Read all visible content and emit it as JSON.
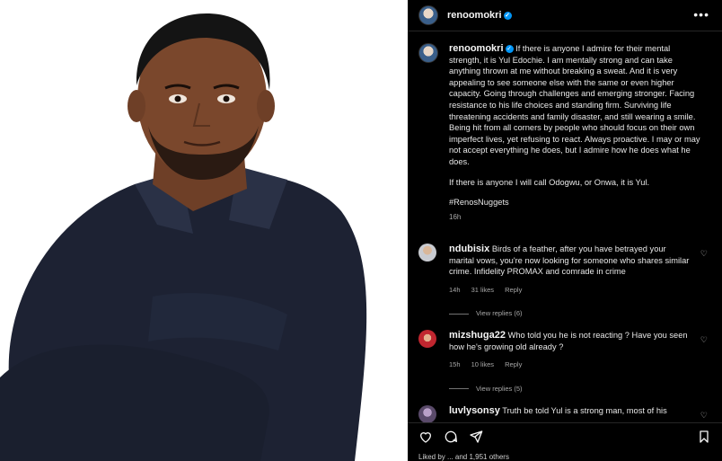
{
  "post": {
    "username": "renoomokri",
    "verified_mark": "✓",
    "more_icon": "more-horizontal-icon"
  },
  "caption": {
    "username": "renoomokri",
    "paragraph1": "If there is anyone I admire for their mental strength, it is Yul Edochie. I am mentally strong and can take anything thrown at me without breaking a sweat. And it is very appealing to see someone else with the same or even higher capacity. Going through challenges and emerging stronger. Facing resistance to his life choices and standing firm. Surviving life threatening accidents and family disaster, and still wearing a smile. Being hit from all corners by people who should focus on their own imperfect lives, yet refusing to react. Always proactive. I may or may not accept everything he does, but I admire how he does what he does.",
    "paragraph2": "If there is anyone I will call Odogwu, or Onwa, it is Yul.",
    "hashtag": "#RenosNuggets",
    "time": "16h"
  },
  "comments": [
    {
      "username": "ndubisix",
      "text": "Birds of a feather, after you have betrayed your marital vows, you're now looking for someone who shares similar crime. Infidelity PROMAX and comrade in crime",
      "time": "14h",
      "likes": "31 likes",
      "reply": "Reply",
      "view_replies": "View replies (6)"
    },
    {
      "username": "mizshuga22",
      "text": "Who told you he is not reacting ? Have you seen how he's growing old already ?",
      "time": "15h",
      "likes": "10 likes",
      "reply": "Reply",
      "view_replies": "View replies (5)"
    },
    {
      "username": "luvlysonsy",
      "text": "Truth be told Yul is a strong man, most of his"
    }
  ],
  "actions": {
    "like_icon": "heart-icon",
    "comment_icon": "comment-icon",
    "share_icon": "send-icon",
    "save_icon": "bookmark-icon"
  },
  "footer": {
    "liked_by": "Liked by ... and 1,951 others"
  },
  "colors": {
    "background": "#000000",
    "verified": "#0095f6",
    "muted_text": "#a8a8a8",
    "divider": "#262626"
  }
}
